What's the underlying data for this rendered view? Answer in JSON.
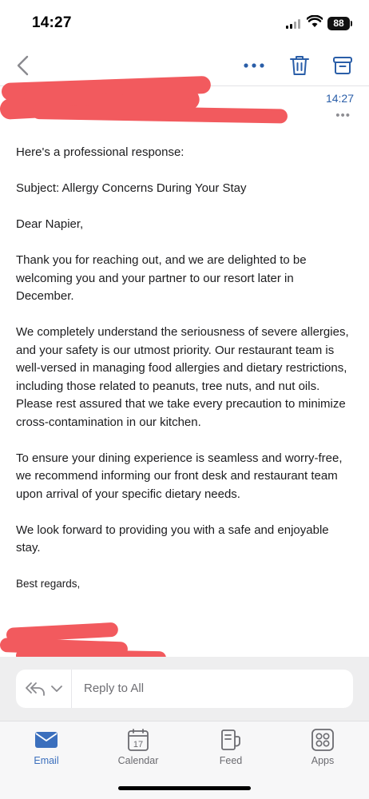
{
  "status": {
    "time": "14:27",
    "battery": "88"
  },
  "toolbar": {
    "back_icon": "chevron-left-icon",
    "more_icon": "ellipsis-icon",
    "delete_icon": "trash-icon",
    "archive_icon": "archive-icon"
  },
  "message": {
    "time": "14:27",
    "more": "•••",
    "paragraphs": [
      "Here's a professional response:",
      "Subject: Allergy Concerns During Your Stay",
      "Dear Napier,",
      "Thank you for reaching out, and we are delighted to be welcoming you and your partner to our resort later in December.",
      "We completely understand the seriousness of severe allergies, and your safety is our utmost priority. Our restaurant team is well-versed in managing food allergies and dietary restrictions, including those related to peanuts, tree nuts, and nut oils. Please rest assured that we take every precaution to minimize cross-contamination in our kitchen.",
      "To ensure your dining experience is seamless and worry-free, we recommend informing our front desk and restaurant team upon arrival of your specific dietary needs.",
      "We look forward to providing you with a safe and enjoyable stay."
    ],
    "signoff": "Best regards,"
  },
  "reply": {
    "label": "Reply to All"
  },
  "tabs": [
    {
      "label": "Email",
      "icon": "envelope-icon",
      "active": true
    },
    {
      "label": "Calendar",
      "icon": "calendar-icon",
      "badge": "17"
    },
    {
      "label": "Feed",
      "icon": "feed-icon"
    },
    {
      "label": "Apps",
      "icon": "apps-grid-icon"
    }
  ],
  "colors": {
    "accent": "#2a5ea8",
    "redaction": "#f25a5e",
    "tab_active": "#3b6fbd"
  }
}
